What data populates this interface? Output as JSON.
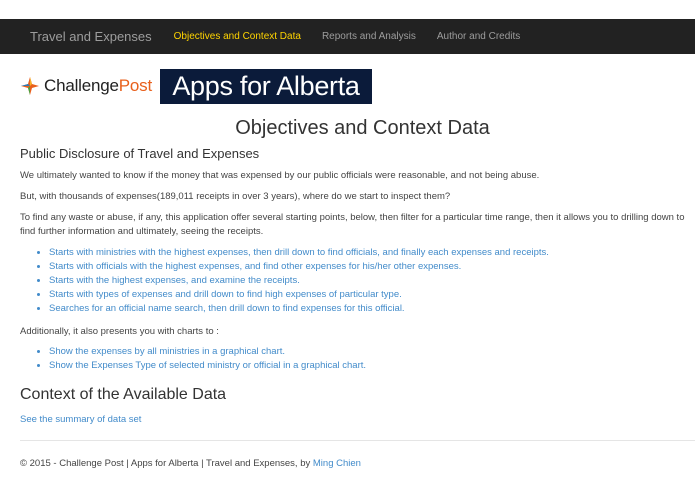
{
  "navbar": {
    "brand": "Travel and Expenses",
    "items": [
      {
        "label": "Objectives and Context Data",
        "active": true
      },
      {
        "label": "Reports and Analysis",
        "active": false
      },
      {
        "label": "Author and Credits",
        "active": false
      }
    ]
  },
  "logos": {
    "challengepost_part1": "Challenge",
    "challengepost_part2": "Post",
    "apps_for_alberta": "Apps for Alberta"
  },
  "page_title": "Objectives and Context Data",
  "section_heading": "Public Disclosure of Travel and Expenses",
  "paragraphs": {
    "p1": "We ultimately wanted to know if the money that was expensed by our public officials were reasonable, and not being abuse.",
    "p2": "But, with thousands of expenses(189,011 receipts in over 3 years), where do we start to inspect them?",
    "p3": "To find any waste or abuse, if any, this application offer several starting points, below, then filter for a particular time range, then it allows you to drilling down to find further information and ultimately, seeing the receipts.",
    "p4": "Additionally, it also presents you with charts to :"
  },
  "starting_points": [
    "Starts with ministries with the highest expenses, then drill down to find officials, and finally each expenses and receipts.",
    "Starts with officials with the highest expenses, and find other expenses for his/her other expenses.",
    "Starts with the highest expenses, and examine the receipts.",
    "Starts with types of expenses and drill down to find high expenses of particular type.",
    "Searches for an official name search, then drill down to find expenses for this official."
  ],
  "charts_links": [
    "Show the expenses by all ministries in a graphical chart.",
    "Show the Expenses Type of selected ministry or official in a graphical chart."
  ],
  "context_heading": "Context of the Available Data",
  "summary_link": "See the summary of data set",
  "footer": {
    "text": "© 2015 - Challenge Post | Apps for Alberta | Travel and Expenses, by ",
    "author": "Ming Chien"
  },
  "colors": {
    "navbar_bg": "#222222",
    "active_nav": "#ffd400",
    "link": "#428bca",
    "challengepost_orange": "#e8601c"
  }
}
